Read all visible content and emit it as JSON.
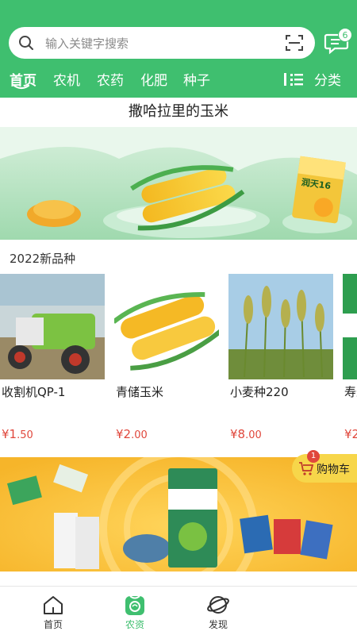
{
  "header": {
    "search_placeholder": "输入关键字搜索",
    "message_badge": "6"
  },
  "tabs": [
    {
      "label": "首页",
      "active": true
    },
    {
      "label": "农机",
      "active": false
    },
    {
      "label": "农药",
      "active": false
    },
    {
      "label": "化肥",
      "active": false
    },
    {
      "label": "种子",
      "active": false
    }
  ],
  "category_label": "分类",
  "main": {
    "title": "撒哈拉里的玉米",
    "banner_pack_text": "润天16",
    "section_title": "2022新品种",
    "products": [
      {
        "name": "收割机QP-1",
        "price_int": "¥1",
        "price_dec": ".50"
      },
      {
        "name": "青储玉米",
        "price_int": "¥2",
        "price_dec": ".00"
      },
      {
        "name": "小麦种220",
        "price_int": "¥8",
        "price_dec": ".00"
      },
      {
        "name": "寿米种",
        "price_int": "¥2",
        "price_dec": ""
      }
    ]
  },
  "cart": {
    "label": "购物车",
    "badge": "1"
  },
  "bottom_nav": [
    {
      "label": "首页",
      "icon": "home-icon"
    },
    {
      "label": "农资",
      "icon": "farm-supply-icon",
      "active": true
    },
    {
      "label": "发现",
      "icon": "discover-planet-icon"
    }
  ],
  "colors": {
    "brand": "#3fbf6f",
    "price": "#e0473c",
    "cart": "#f7d64a"
  }
}
